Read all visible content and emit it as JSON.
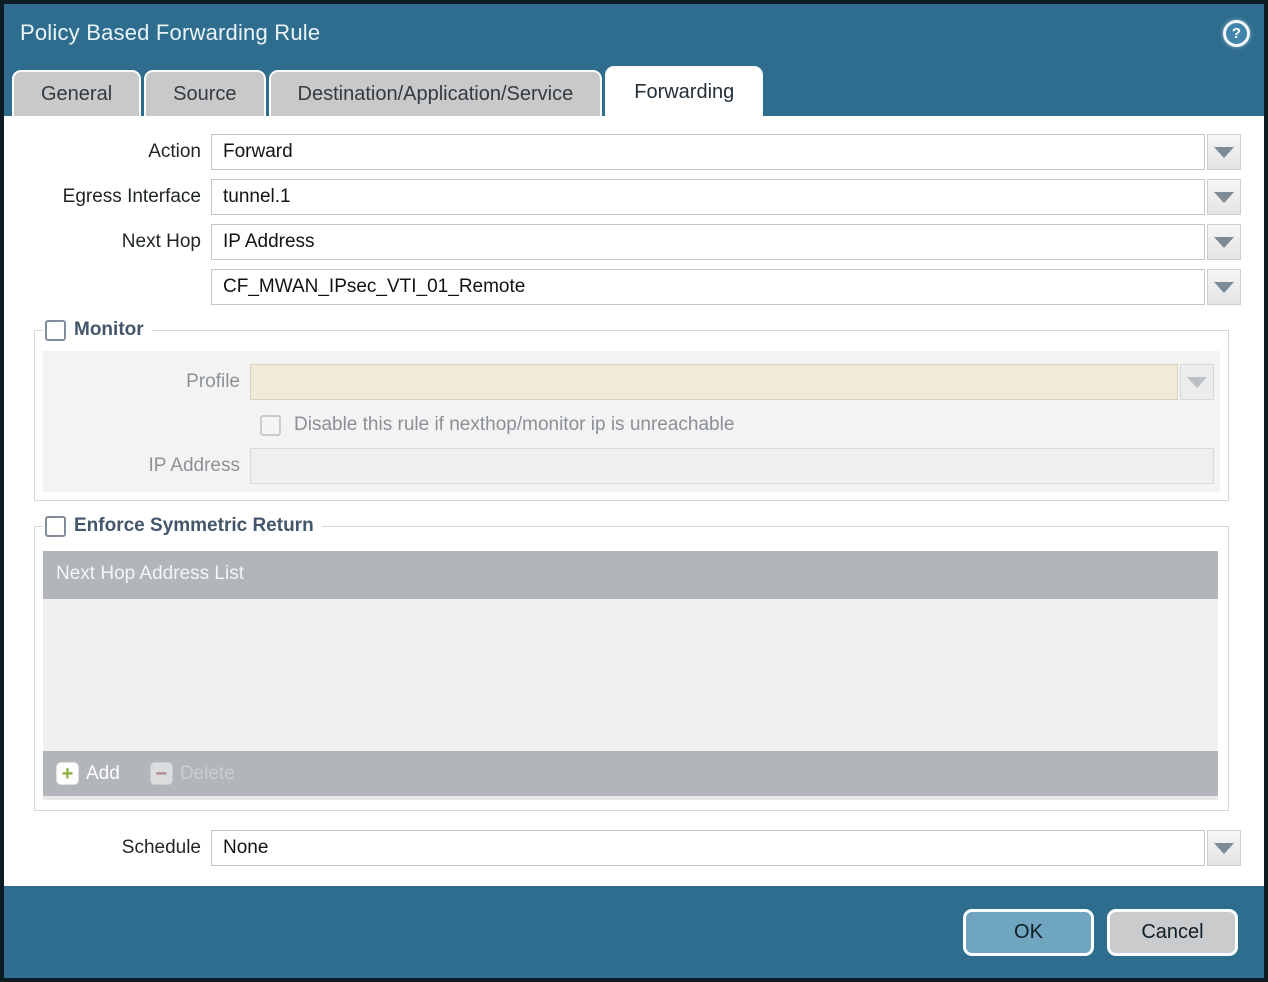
{
  "dialog": {
    "title": "Policy Based Forwarding Rule",
    "help_icon": "?",
    "tabs": [
      {
        "label": "General",
        "active": false
      },
      {
        "label": "Source",
        "active": false
      },
      {
        "label": "Destination/Application/Service",
        "active": false
      },
      {
        "label": "Forwarding",
        "active": true
      }
    ],
    "fields": {
      "action": {
        "label": "Action",
        "value": "Forward"
      },
      "egress_interface": {
        "label": "Egress Interface",
        "value": "tunnel.1"
      },
      "next_hop": {
        "label": "Next Hop",
        "value": "IP Address"
      },
      "next_hop_address": {
        "value": "CF_MWAN_IPsec_VTI_01_Remote"
      },
      "schedule": {
        "label": "Schedule",
        "value": "None"
      }
    },
    "monitor": {
      "legend": "Monitor",
      "checked": false,
      "profile": {
        "label": "Profile",
        "value": ""
      },
      "disable_rule": {
        "label": "Disable this rule if nexthop/monitor ip is unreachable",
        "checked": false
      },
      "ip_address": {
        "label": "IP Address",
        "value": ""
      }
    },
    "symmetric_return": {
      "legend": "Enforce Symmetric Return",
      "checked": false,
      "list_header": "Next Hop Address List",
      "rows": [],
      "add_label": "Add",
      "delete_label": "Delete",
      "add_icon": "+",
      "delete_icon": "−"
    },
    "footer": {
      "ok_label": "OK",
      "cancel_label": "Cancel"
    },
    "colors": {
      "titlebar": "#2e6d8d",
      "ok_button": "#6fa5be",
      "cancel_button": "#c9cbcd",
      "profile_field": "#f0ebd9",
      "list_chrome": "#b2b6ba",
      "add_plus": "#8cb03f",
      "delete_minus": "#a9625c"
    }
  }
}
